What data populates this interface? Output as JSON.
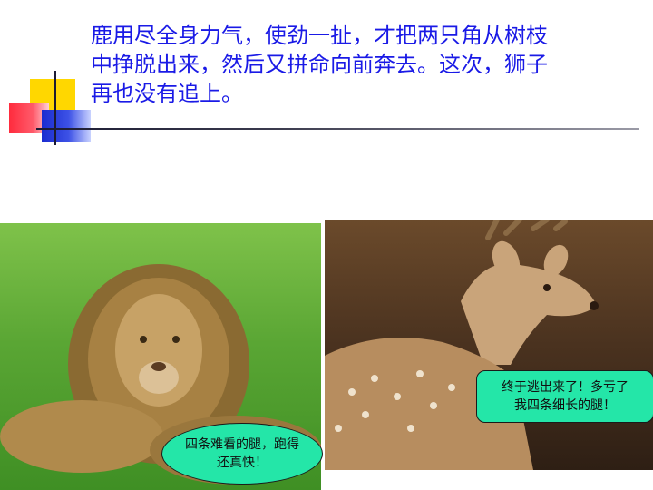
{
  "slide": {
    "text": "鹿用尽全身力气，使劲一扯，才把两只角从树枝\n中挣脱出来，然后又拼命向前奔去。这次，狮子\n再也没有追上。"
  },
  "images": {
    "lion_alt": "lion",
    "deer_alt": "deer"
  },
  "bubbles": {
    "lion": "四条难看的腿，跑得\n还真快！",
    "deer": "终于逃出来了！多亏了\n我四条细长的腿！"
  },
  "colors": {
    "text": "#1a1ae6",
    "bubble": "#24e6a8",
    "deco_yellow": "#ffd700",
    "deco_red": "#ff2b3d",
    "deco_blue": "#1a2bd0"
  }
}
